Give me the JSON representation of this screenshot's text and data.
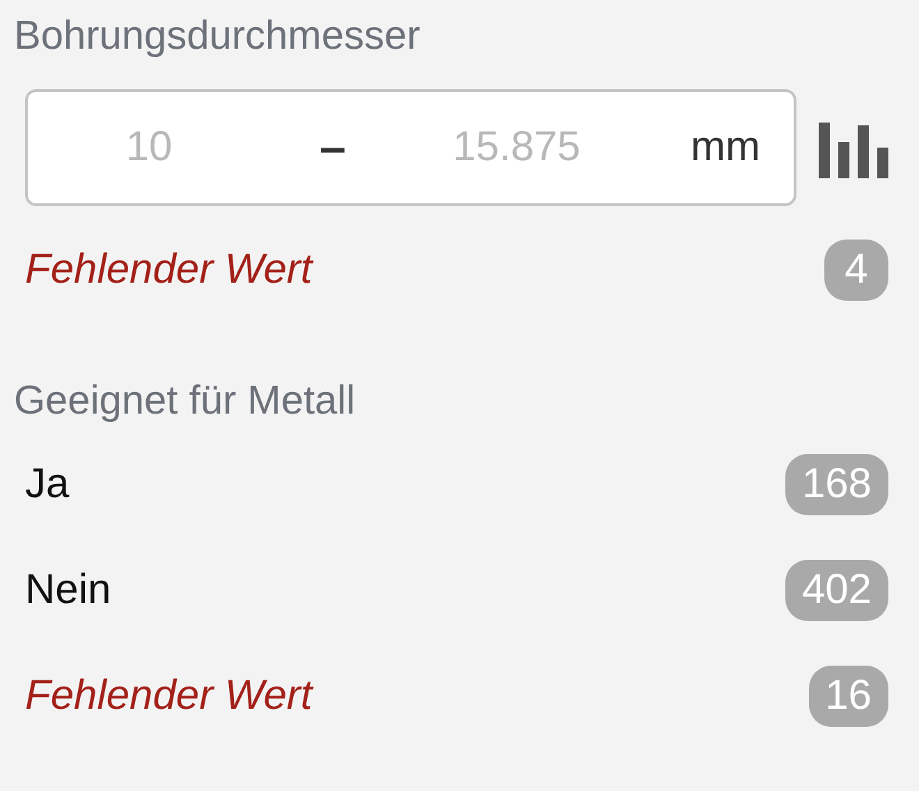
{
  "facets": [
    {
      "kind": "range",
      "title": "Bohrungsdurchmesser",
      "min": {
        "placeholder": "10"
      },
      "separator": "–",
      "max": {
        "placeholder": "15.875"
      },
      "unit": "mm",
      "items": [
        {
          "kind": "missing",
          "label": "Fehlender Wert",
          "count": "4"
        }
      ]
    },
    {
      "kind": "list",
      "title": "Geeignet für Metall",
      "items": [
        {
          "kind": "value",
          "label": "Ja",
          "count": "168"
        },
        {
          "kind": "value",
          "label": "Nein",
          "count": "402"
        },
        {
          "kind": "missing",
          "label": "Fehlender Wert",
          "count": "16"
        }
      ]
    }
  ]
}
